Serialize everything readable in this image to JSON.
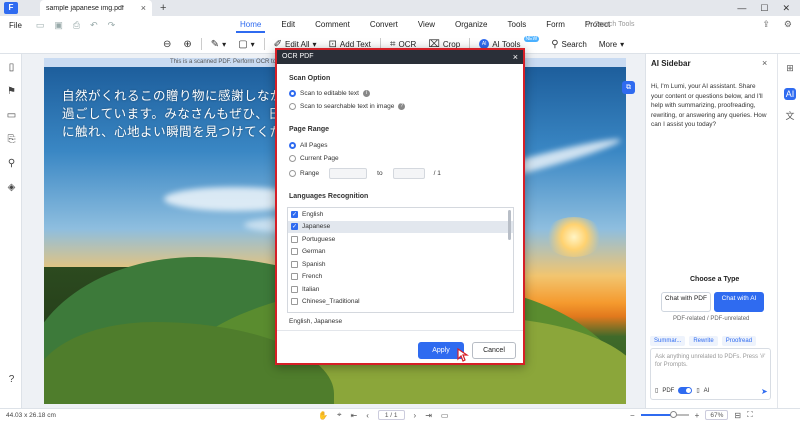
{
  "titlebar": {
    "tab_title": "sample japanese img.pdf"
  },
  "menubar": {
    "file": "File",
    "tabs": [
      "Home",
      "Edit",
      "Comment",
      "Convert",
      "View",
      "Organize",
      "Tools",
      "Form",
      "Protect"
    ],
    "search_tools": "Search Tools"
  },
  "toolbar": {
    "edit_all": "Edit All",
    "add_text": "Add Text",
    "ocr": "OCR",
    "crop": "Crop",
    "ai_tools": "AI Tools",
    "new_badge": "NEW",
    "search": "Search",
    "more": "More"
  },
  "document": {
    "banner": "This is a scanned PDF. Perform OCR to your ",
    "text_lines": [
      "自然がくれるこの贈り物に感謝しながら、",
      "過ごしています。みなさんもぜひ、日常の",
      "に触れ、心地よい瞬間を見つけてくださ"
    ]
  },
  "ocr_dialog": {
    "title": "OCR PDF",
    "scan_option_heading": "Scan Option",
    "scan_options": [
      "Scan to editable text",
      "Scan to searchable text in image"
    ],
    "page_range_heading": "Page Range",
    "page_options": [
      "All Pages",
      "Current Page",
      "Range"
    ],
    "range_to": "to",
    "range_total": "/ 1",
    "languages_heading": "Languages Recognition",
    "languages": [
      "English",
      "Japanese",
      "Portuguese",
      "German",
      "Spanish",
      "French",
      "Italian",
      "Chinese_Traditional"
    ],
    "checked": [
      true,
      true,
      false,
      false,
      false,
      false,
      false,
      false
    ],
    "selected_summary": "English,  Japanese",
    "apply": "Apply",
    "cancel": "Cancel"
  },
  "sidebar": {
    "title": "AI Sidebar",
    "message": "Hi, I'm Lumi, your AI assistant. Share your content or questions below, and I'll help with summarizing, proofreading, rewriting, or answering any queries. How can I assist you today?",
    "choose_type": "Choose a Type",
    "chat_pdf": "Chat with PDF",
    "chat_ai": "Chat with AI",
    "pdf_related": "PDF-related / PDF-unrelated",
    "chips": [
      "Summar...",
      "Rewrite",
      "Proofread"
    ],
    "placeholder": "Ask anything unrelated to PDFs. Press '#' for Prompts.",
    "pdf_label": "PDF",
    "ai_label": "AI"
  },
  "status": {
    "dimensions": "44.03 x 26.18 cm",
    "page_current": "1",
    "page_total": "/ 1",
    "zoom": "67%",
    "zoom_level": 0.67
  },
  "colors": {
    "accent": "#2f6bf0",
    "dialog_border": "#d61f27",
    "dialog_header": "#2a2f38"
  }
}
